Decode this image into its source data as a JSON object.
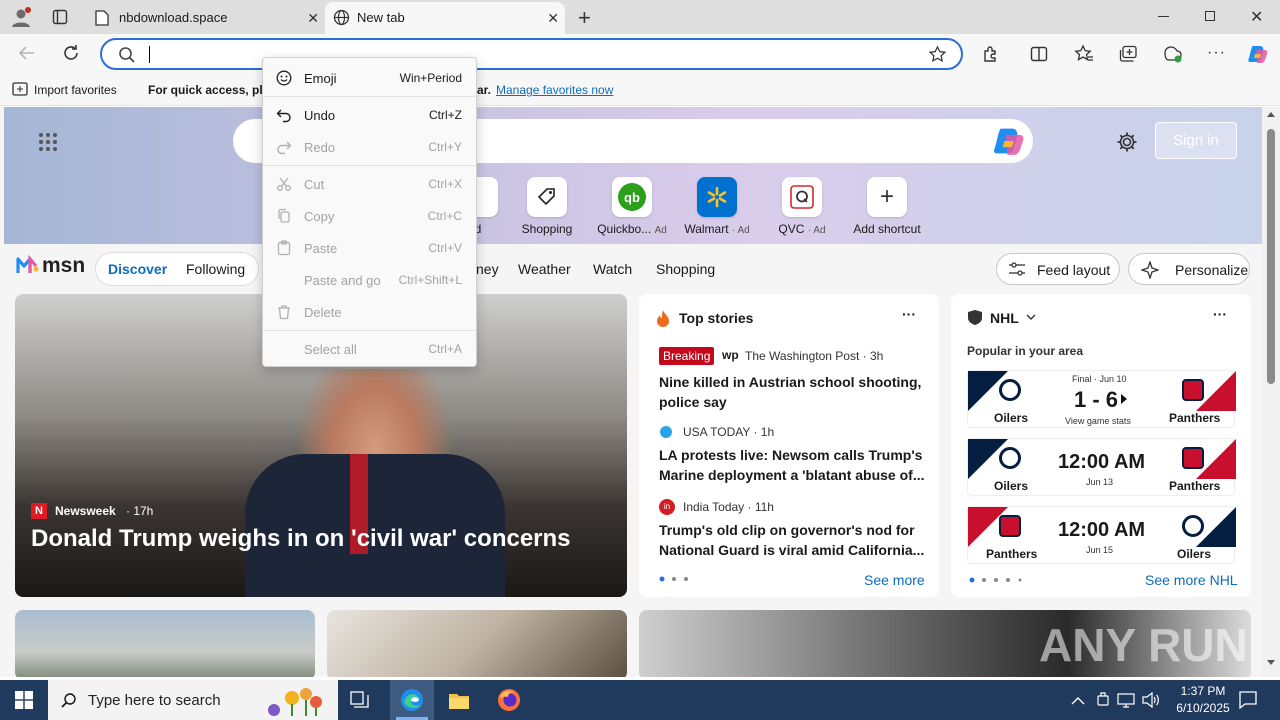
{
  "tabs": [
    {
      "title": "nbdownload.space"
    },
    {
      "title": "New tab"
    }
  ],
  "address": {
    "value": "",
    "placeholder": ""
  },
  "favorites_bar": {
    "import_label": "Import favorites",
    "hint": "For quick access, pla",
    "hint_tail": "ar.",
    "manage_link": "Manage favorites now"
  },
  "shortcuts": [
    {
      "label": "d",
      "ad": ""
    },
    {
      "label": "Shopping",
      "ad": ""
    },
    {
      "label": "Quickbo...",
      "ad": "Ad"
    },
    {
      "label": "Walmart",
      "ad": "· Ad"
    },
    {
      "label": "QVC",
      "ad": "· Ad"
    },
    {
      "label": "Add shortcut",
      "ad": ""
    }
  ],
  "signin_label": "Sign in",
  "msn": {
    "logo": "msn",
    "nav": [
      "Discover",
      "Following",
      "ney",
      "Weather",
      "Watch",
      "Shopping"
    ],
    "feed_layout": "Feed layout",
    "personalize": "Personalize"
  },
  "hero_story": {
    "source": "Newsweek",
    "age": "· 17h",
    "headline": "Donald Trump weighs in on 'civil war' concerns"
  },
  "top_stories": {
    "title": "Top stories",
    "items": [
      {
        "badge": "Breaking",
        "source": "The Washington Post · 3h",
        "headline1": "Nine killed in Austrian school shooting,",
        "headline2": "police say"
      },
      {
        "source": "USA TODAY · 1h",
        "headline1": "LA protests live: Newsom calls Trump's",
        "headline2": "Marine deployment a 'blatant abuse of..."
      },
      {
        "source": "India Today · 11h",
        "headline1": "Trump's old clip on governor's nod for",
        "headline2": "National Guard is viral amid California..."
      }
    ],
    "see_more": "See more"
  },
  "nhl": {
    "title": "NHL",
    "subtitle": "Popular in your area",
    "games": [
      {
        "home": "Oilers",
        "away": "Panthers",
        "status": "Final · Jun 10",
        "score": "1 - 6",
        "sub": "View game stats"
      },
      {
        "home": "Oilers",
        "away": "Panthers",
        "time": "12:00 AM",
        "date": "Jun 13"
      },
      {
        "home": "Panthers",
        "away": "Oilers",
        "time": "12:00 AM",
        "date": "Jun 15"
      }
    ],
    "see_more": "See more NHL"
  },
  "context_menu": [
    {
      "label": "Emoji",
      "shortcut": "Win+Period",
      "enabled": true
    },
    {
      "label": "Undo",
      "shortcut": "Ctrl+Z",
      "enabled": true
    },
    {
      "label": "Redo",
      "shortcut": "Ctrl+Y",
      "enabled": false
    },
    {
      "label": "Cut",
      "shortcut": "Ctrl+X",
      "enabled": false
    },
    {
      "label": "Copy",
      "shortcut": "Ctrl+C",
      "enabled": false
    },
    {
      "label": "Paste",
      "shortcut": "Ctrl+V",
      "enabled": false
    },
    {
      "label": "Paste and go",
      "shortcut": "Ctrl+Shift+L",
      "enabled": false
    },
    {
      "label": "Delete",
      "shortcut": "",
      "enabled": false
    },
    {
      "label": "Select all",
      "shortcut": "Ctrl+A",
      "enabled": false
    }
  ],
  "taskbar": {
    "search_placeholder": "Type here to search",
    "time": "1:37 PM",
    "date": "6/10/2025"
  },
  "watermark": "ANY RUN",
  "colors": {
    "accent": "#2c6ed5",
    "breaking": "#c4081b",
    "msn_link": "#0f6cbd",
    "taskbar": "#203a5e"
  }
}
